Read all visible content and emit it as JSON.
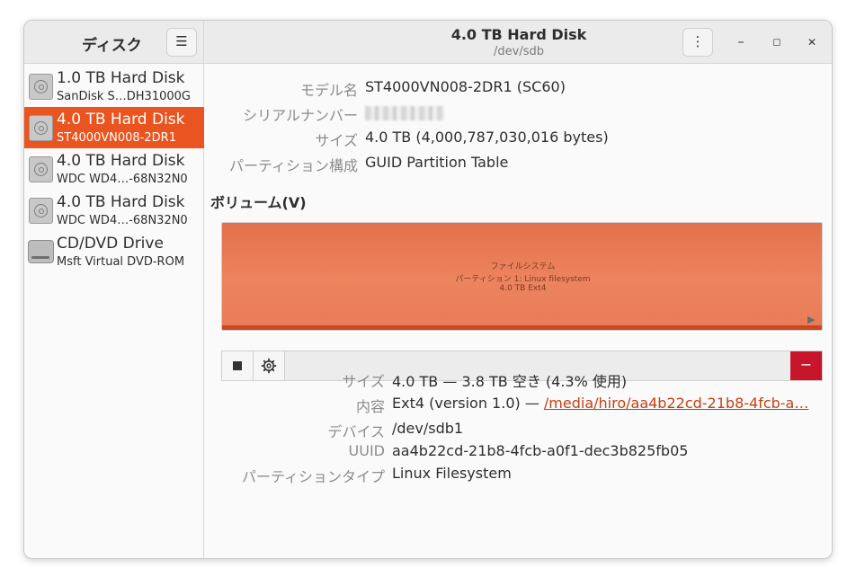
{
  "sidebar": {
    "title": "ディスク",
    "menu_icon": "hamburger-menu-icon",
    "drives": [
      {
        "name": "1.0 TB Hard Disk",
        "model": "SanDisk S…DH31000G",
        "icon": "hard-disk-icon",
        "selected": false
      },
      {
        "name": "4.0 TB Hard Disk",
        "model": "ST4000VN008-2DR1",
        "icon": "hard-disk-icon",
        "selected": true
      },
      {
        "name": "4.0 TB Hard Disk",
        "model": "WDC WD4…-68N32N0",
        "icon": "hard-disk-icon",
        "selected": false
      },
      {
        "name": "4.0 TB Hard Disk",
        "model": "WDC WD4…-68N32N0",
        "icon": "hard-disk-icon",
        "selected": false
      },
      {
        "name": "CD/DVD Drive",
        "model": "Msft Virtual DVD-ROM",
        "icon": "optical-drive-icon",
        "selected": false
      }
    ]
  },
  "header": {
    "title": "4.0 TB Hard Disk",
    "subtitle": "/dev/sdb",
    "kebab_glyph": "⋮",
    "minimize_glyph": "–",
    "maximize_glyph": "◻",
    "close_glyph": "✕"
  },
  "disk_info": {
    "model_label": "モデル名",
    "model_value": "ST4000VN008-2DR1 (SC60)",
    "serial_label": "シリアルナンバー",
    "size_label": "サイズ",
    "size_value": "4.0 TB (4,000,787,030,016 bytes)",
    "partitioning_label": "パーティション構成",
    "partitioning_value": "GUID Partition Table"
  },
  "volumes": {
    "section_title": "ボリューム(V)",
    "partition": {
      "line1": "ファイルシステム",
      "line2": "パーティション 1: Linux filesystem",
      "line3": "4.0 TB Ext4"
    },
    "toolbar": {
      "stop_icon": "stop-icon",
      "settings_icon": "gear-icon",
      "remove_glyph": "−"
    }
  },
  "partition_info": {
    "size_label": "サイズ",
    "size_value": "4.0 TB — 3.8 TB 空き (4.3% 使用)",
    "contents_label": "内容",
    "contents_prefix": "Ext4 (version 1.0) — ",
    "contents_link": "/media/hiro/aa4b22cd-21b8-4fcb-a…",
    "device_label": "デバイス",
    "device_value": "/dev/sdb1",
    "uuid_label": "UUID",
    "uuid_value": "aa4b22cd-21b8-4fcb-a0f1-dec3b825fb05",
    "type_label": "パーティションタイプ",
    "type_value": "Linux Filesystem"
  },
  "colors": {
    "accent": "#e95420",
    "partition_fill": "#ec845f",
    "remove_button": "#c7162b",
    "link": "#c34113"
  }
}
